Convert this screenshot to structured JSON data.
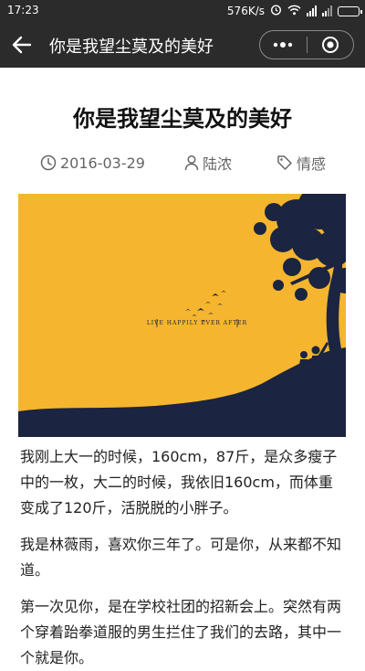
{
  "status_bar": {
    "time": "17:23",
    "net_speed": "576K/s"
  },
  "nav": {
    "title": "你是我望尘莫及的美好",
    "icons": [
      "back-arrow",
      "more-dots",
      "close-target"
    ]
  },
  "article": {
    "title": "你是我望尘莫及的美好",
    "date": "2016-03-29",
    "author": "陆浓",
    "tag": "情感",
    "cover_caption": "LIVE HAPPILY EVER AFTER",
    "paragraphs": [
      "我刚上大一的时候，160cm，87斤，是众多瘦子中的一枚，大二的时候，我依旧160cm，而体重变成了120斤，活脱脱的小胖子。",
      "我是林薇雨，喜欢你三年了。可是你，从来都不知道。",
      "第一次见你，是在学校社团的招新会上。突然有两个穿着跆拳道服的男生拦住了我们的去路，其中一个就是你。"
    ]
  },
  "colors": {
    "bar_bg": "#2b2b2b",
    "cover_yellow": "#f5b52e",
    "cover_navy": "#1b2440"
  }
}
